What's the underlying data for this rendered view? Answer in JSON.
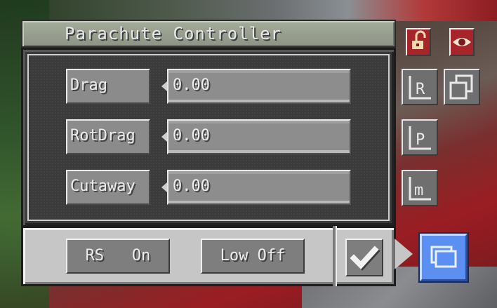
{
  "window": {
    "title": "Parachute Controller"
  },
  "fields": [
    {
      "label": "Drag",
      "value": "0.00"
    },
    {
      "label": "RotDrag",
      "value": "0.00"
    },
    {
      "label": "Cutaway",
      "value": "0.00"
    }
  ],
  "bottom_bar": {
    "rs_button": "RS   On",
    "low_button": "Low Off"
  },
  "icons": {
    "top": [
      "unlock-icon",
      "eye-icon"
    ],
    "side": [
      "camera-rotation-icon",
      "copy-icon",
      "camera-position-icon",
      "camera-m-icon"
    ],
    "bottom": [
      "checkmark-icon",
      "folder-icon"
    ]
  },
  "colors": {
    "accent_blue": "#5b8ff2",
    "icon_red": "#a7242a",
    "panel_dark": "#3a3a3a",
    "panel_light": "#c6c6c6"
  }
}
